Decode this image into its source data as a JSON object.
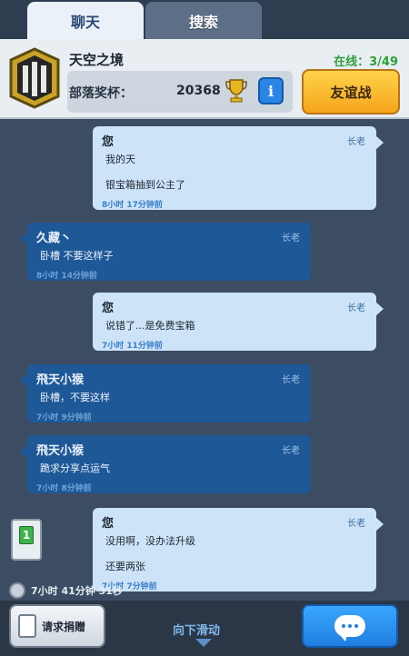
{
  "tabs": [
    {
      "label": "聊天"
    },
    {
      "label": "搜索"
    }
  ],
  "clan": {
    "name": "天空之境",
    "online_label": "在线：",
    "online_count": "3/49",
    "trophy_label": "部落奖杯：",
    "trophy_count": "20368",
    "info_icon": "i",
    "friend_battle_label": "友谊战"
  },
  "messages": [
    {
      "side": "self",
      "sender": "您",
      "role": "长老",
      "lines": [
        "我的天",
        "",
        "银宝箱抽到公主了"
      ],
      "time": "8小时 17分钟前"
    },
    {
      "side": "other",
      "sender": "久藏丶",
      "role": "长老",
      "lines": [
        "卧槽 不要这样子"
      ],
      "time": "8小时 14分钟前"
    },
    {
      "side": "self",
      "sender": "您",
      "role": "长老",
      "lines": [
        "说错了...是免费宝箱"
      ],
      "time": "7小时 11分钟前"
    },
    {
      "side": "other",
      "sender": "飛天小猴",
      "role": "长老",
      "lines": [
        "卧槽，不要这样"
      ],
      "time": "7小时 9分钟前"
    },
    {
      "side": "other",
      "sender": "飛天小猴",
      "role": "长老",
      "lines": [
        "跪求分享点运气"
      ],
      "time": "7小时 8分钟前"
    },
    {
      "side": "self",
      "sender": "您",
      "role": "长老",
      "lines": [
        "没用啊，没办法升级",
        "",
        "还要两张"
      ],
      "time": "7小时 7分钟前"
    }
  ],
  "card_request": {
    "card_number": "1",
    "timer": "7小时 41分钟 31秒"
  },
  "bottom": {
    "request_label": "请求捐赠",
    "scroll_label": "向下滑动"
  },
  "colors": {
    "accent_gold": "#f5a51c",
    "accent_blue": "#2a86e6",
    "online_green": "#2e9f3b"
  }
}
